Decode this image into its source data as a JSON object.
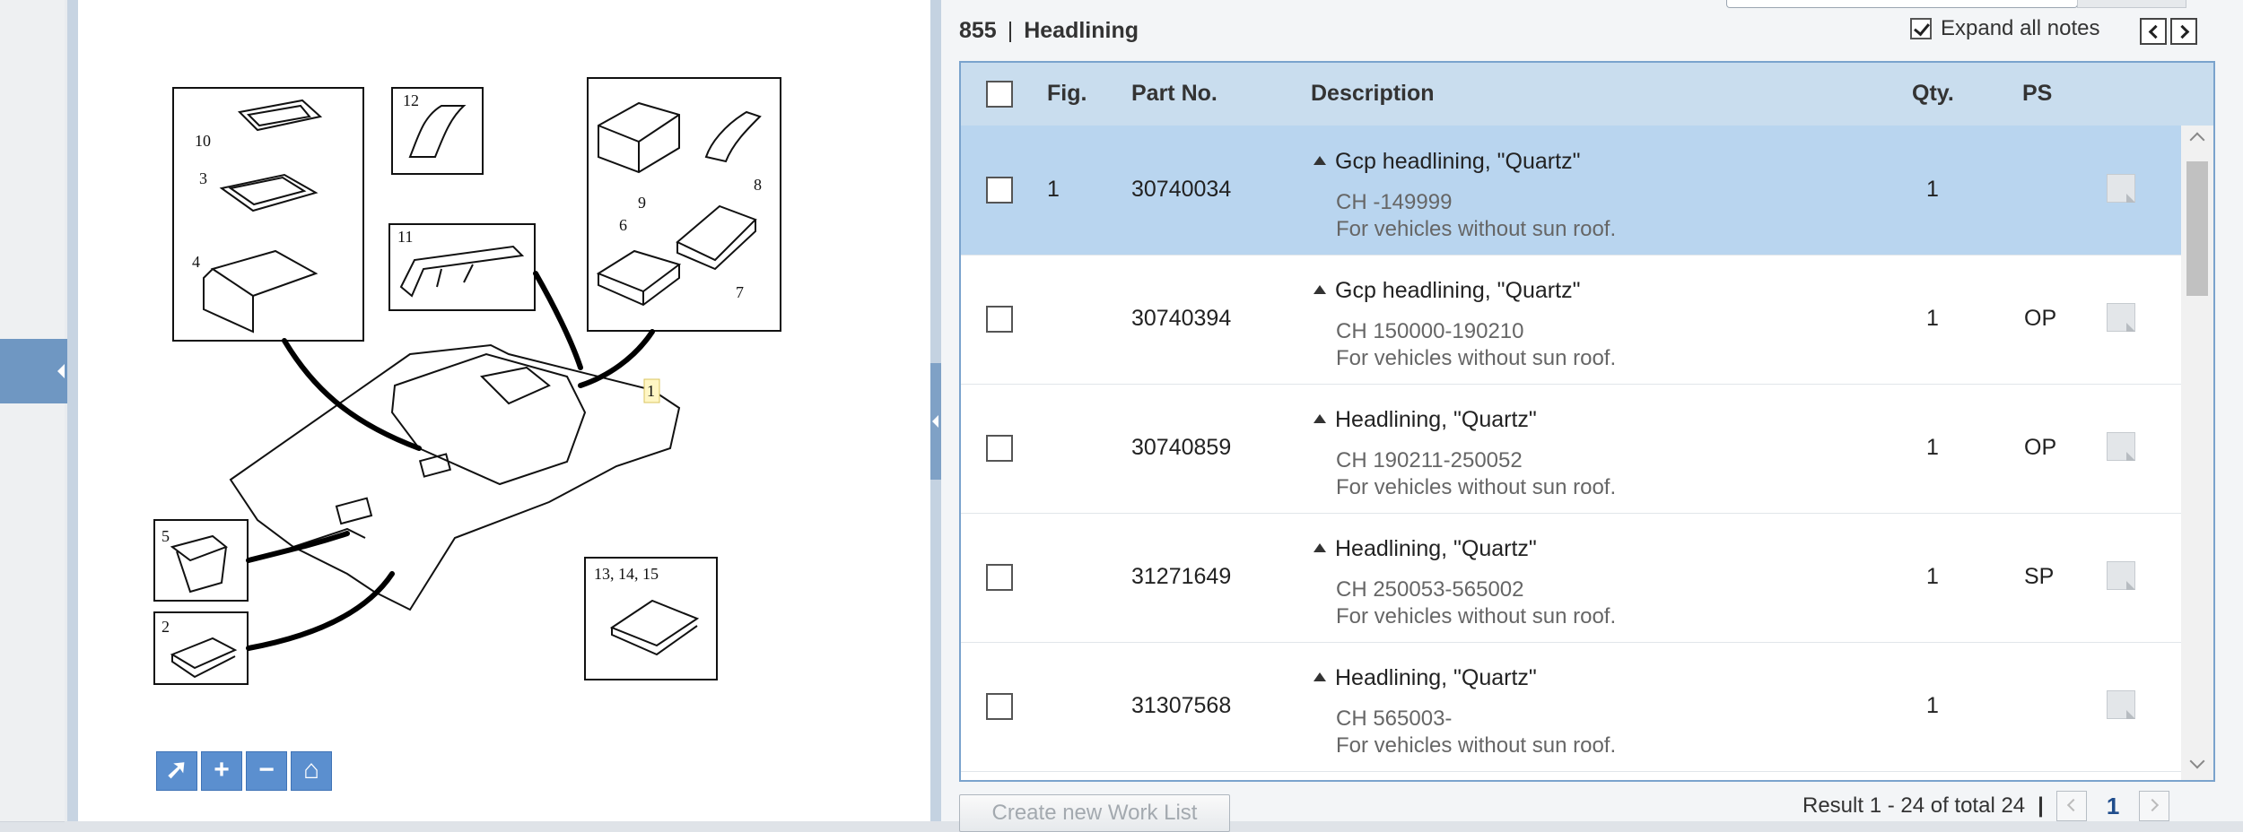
{
  "header": {
    "group_no": "855",
    "group_name": "Headlining",
    "expand_all_notes": "Expand all notes",
    "expand_checked": true
  },
  "table": {
    "columns": {
      "fig": "Fig.",
      "part_no": "Part No.",
      "description": "Description",
      "qty": "Qty.",
      "ps": "PS"
    },
    "rows": [
      {
        "fig": "1",
        "part_no": "30740034",
        "name": "Gcp headlining, \"Quartz\"",
        "chassis": "CH -149999",
        "note": "For vehicles without sun roof.",
        "qty": "1",
        "ps": "",
        "selected": true
      },
      {
        "fig": "",
        "part_no": "30740394",
        "name": "Gcp headlining, \"Quartz\"",
        "chassis": "CH 150000-190210",
        "note": "For vehicles without sun roof.",
        "qty": "1",
        "ps": "OP",
        "selected": false
      },
      {
        "fig": "",
        "part_no": "30740859",
        "name": "Headlining, \"Quartz\"",
        "chassis": "CH 190211-250052",
        "note": "For vehicles without sun roof.",
        "qty": "1",
        "ps": "OP",
        "selected": false
      },
      {
        "fig": "",
        "part_no": "31271649",
        "name": "Headlining, \"Quartz\"",
        "chassis": "CH 250053-565002",
        "note": "For vehicles without sun roof.",
        "qty": "1",
        "ps": "SP",
        "selected": false
      },
      {
        "fig": "",
        "part_no": "31307568",
        "name": "Headlining, \"Quartz\"",
        "chassis": "CH 565003-",
        "note": "For vehicles without sun roof.",
        "qty": "1",
        "ps": "",
        "selected": false
      }
    ]
  },
  "footer": {
    "create_button": "Create new Work List",
    "result_text": "Result 1 - 24 of total 24",
    "divider": "|",
    "current_page": "1"
  },
  "diagram": {
    "callouts": {
      "n10": "10",
      "n3": "3",
      "n4": "4",
      "n12": "12",
      "n11": "11",
      "n9": "9",
      "n8": "8",
      "n6": "6",
      "n7": "7",
      "n1": "1",
      "n5": "5",
      "n2": "2",
      "n131415": "13, 14, 15"
    }
  },
  "tools": {
    "icons": [
      "pointer-icon",
      "zoom-in-icon",
      "zoom-out-icon",
      "home-icon"
    ]
  },
  "colors": {
    "selected_row": "#b9d5ef",
    "header_row": "#c9ddee",
    "accent": "#5b8fcf"
  }
}
